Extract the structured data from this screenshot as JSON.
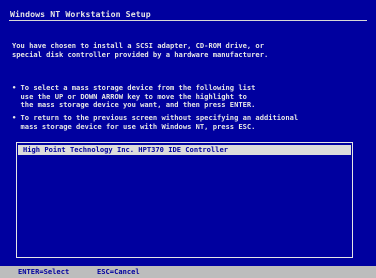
{
  "window": {
    "title": "Windows NT Workstation Setup"
  },
  "intro": "You have chosen to install a SCSI adapter, CD-ROM drive, or\nspecial disk controller provided by a hardware manufacturer.",
  "instructions": [
    "• To select a mass storage device from the following list\n  use the UP or DOWN ARROW key to move the highlight to\n  the mass storage device you want, and then press ENTER.",
    "• To return to the previous screen without specifying an additional\n  mass storage device for use with Windows NT, press ESC."
  ],
  "device_list": {
    "items": [
      {
        "label": "High Point Technology Inc. HPT370 IDE Controller",
        "selected": true
      }
    ]
  },
  "status_bar": {
    "keys": [
      "ENTER=Select",
      "ESC=Cancel"
    ]
  },
  "colors": {
    "background": "#00009f",
    "text": "#e6e6e6",
    "highlight": "#dcdcdc",
    "status_bar": "#bdbdbd"
  }
}
